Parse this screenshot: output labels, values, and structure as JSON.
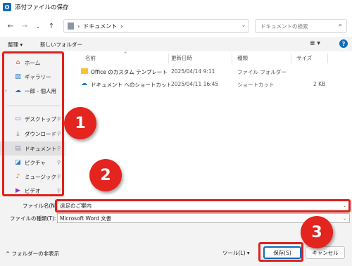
{
  "window": {
    "title": "添付ファイルの保存",
    "app_icon": "O"
  },
  "nav": {
    "back_icon": "←",
    "forward_icon": "→",
    "up_icon": "↑",
    "recent_icon": "⌄",
    "refresh_icon": "⟳",
    "address": {
      "sep": "›",
      "location": "ドキュメント",
      "chevron": "›"
    },
    "search_placeholder": "ドキュメントの検索"
  },
  "commands": {
    "organize": "整理 ▾",
    "new_folder": "新しいフォルダー",
    "view_icon": "≣ ▾",
    "help": "?"
  },
  "sidebar": {
    "items": [
      {
        "label": "ホーム",
        "icon": "⌂",
        "color": "#e0542c"
      },
      {
        "label": "ギャラリー",
        "icon": "▨",
        "color": "#2a79c9"
      },
      {
        "label": "一郎 - 個人用",
        "icon": "☁",
        "color": "#1e78c8",
        "expand": "›"
      },
      {
        "label": "デスクトップ",
        "icon": "▭",
        "color": "#2a79c9",
        "pin": "⚲"
      },
      {
        "label": "ダウンロード",
        "icon": "⤓",
        "color": "#1f8a4c",
        "pin": "⚲"
      },
      {
        "label": "ドキュメント",
        "icon": "▤",
        "color": "#8a96a8",
        "pin": "⚲"
      },
      {
        "label": "ピクチャ",
        "icon": "◪",
        "color": "#2a79c9",
        "pin": "⚲"
      },
      {
        "label": "ミュージック",
        "icon": "♪",
        "color": "#e0542c",
        "pin": "⚲"
      },
      {
        "label": "ビデオ",
        "icon": "▶",
        "color": "#8a3fb8",
        "pin": "⚲"
      }
    ]
  },
  "table": {
    "columns": [
      "名前",
      "更新日時",
      "種類",
      "サイズ"
    ],
    "sort_indicator": "^",
    "rows": [
      {
        "name": "Office のカスタム テンプレート",
        "modified": "2025/04/14 9:11",
        "type": "ファイル フォルダー",
        "size": ""
      },
      {
        "name": "ドキュメント へのショートカット (One...",
        "modified": "2025/04/11 16:45",
        "type": "ショートカット",
        "size": "2 KB"
      }
    ]
  },
  "form": {
    "filename_label": "ファイル名(N):",
    "filename_value": "遠足のご案内",
    "filetype_label": "ファイルの種類(T):",
    "filetype_value": "Microsoft Word 文書",
    "chevron": "⌄"
  },
  "footer": {
    "hide_folders": "^ フォルダーの非表示",
    "tools": "ツール(L)  ▾",
    "save": "保存(S)",
    "cancel": "キャンセル"
  },
  "callouts": [
    "1",
    "2",
    "3"
  ],
  "colors": {
    "accent": "#0f6cbd",
    "highlight": "#e0201b",
    "badge": "#e3241f"
  }
}
